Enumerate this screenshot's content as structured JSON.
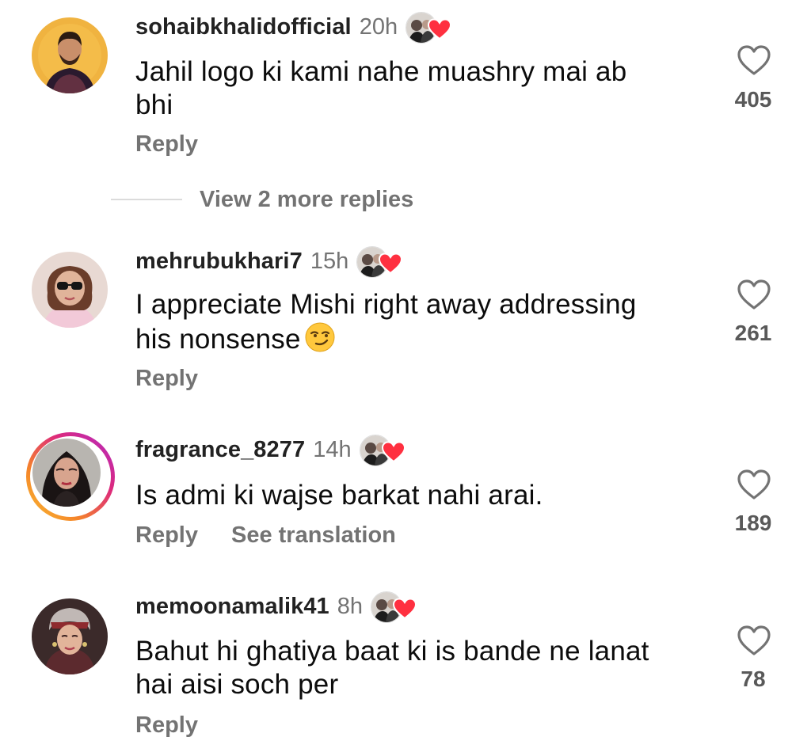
{
  "comments": [
    {
      "username": "sohaibkhalidofficial",
      "time": "20h",
      "text_lines": [
        "Jahil logo ki kami nahe muashry mai ab",
        "bhi"
      ],
      "likes": "405",
      "reply_label": "Reply"
    },
    {
      "username": "mehrubukhari7",
      "time": "15h",
      "text_lines": [
        "I appreciate Mishi right away addressing",
        "his nonsense"
      ],
      "likes": "261",
      "reply_label": "Reply"
    },
    {
      "username": "fragrance_8277",
      "time": "14h",
      "text_lines": [
        "Is admi ki wajse barkat nahi arai."
      ],
      "likes": "189",
      "reply_label": "Reply",
      "translate_label": "See translation"
    },
    {
      "username": "memoonamalik41",
      "time": "8h",
      "text_lines": [
        "Bahut hi ghatiya baat ki is bande ne lanat",
        "hai aisi soch per"
      ],
      "likes": "78",
      "reply_label": "Reply"
    }
  ],
  "view_replies_label": "View 2 more replies",
  "icons": {
    "like": "heart-outline-icon",
    "creator_liked": "creator-liked-heart-icon",
    "emoji": "smirking-face-emoji"
  },
  "colors": {
    "heart_red": "#ff3040",
    "secondary_text": "#737373",
    "story_ring_start": "#f9c033",
    "story_ring_end": "#b02bc8"
  }
}
